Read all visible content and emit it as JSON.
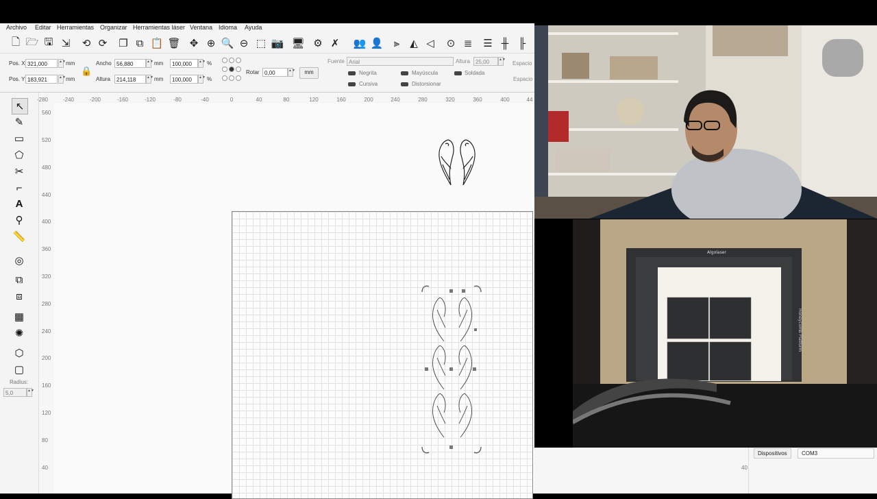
{
  "menu": [
    "Archivo",
    "Editar",
    "Herramientas",
    "Organizar",
    "Herramientas láser",
    "Ventana",
    "Idioma",
    "Ayuda"
  ],
  "props": {
    "pos_x_label": "Pos. X",
    "pos_x": "321,000",
    "pos_y_label": "Pos. Y",
    "pos_y": "183,921",
    "unit": "mm",
    "width_label": "Ancho",
    "width": "56,880",
    "height_label": "Altura",
    "height": "214,118",
    "scale_w": "100,000",
    "scale_h": "100,000",
    "percent": "%",
    "rotate_label": "Rotar",
    "rotate": "0,00",
    "mm_button": "mm",
    "font_label": "Fuente",
    "font": "Arial",
    "font_height_label": "Altura",
    "font_height": "25,00",
    "spacing_label_1": "Espacio",
    "spacing_label_2": "Espacio",
    "bold": "Negrita",
    "italic": "Cursiva",
    "uppercase": "Mayúscula",
    "distort": "Distorsionar",
    "welded": "Soldada"
  },
  "left_tools": {
    "radius_label": "Radius:",
    "radius_value": "5,0",
    "icons": [
      "select-arrow-icon",
      "pen-icon",
      "rectangle-icon",
      "polygon-icon",
      "scissors-icon",
      "corner-icon",
      "text-icon",
      "position-marker-icon",
      "ruler-icon",
      "offset-icon",
      "copy-icon",
      "group-icon",
      "grid-array-icon",
      "circular-array-icon",
      "node-edit-icon",
      "rounded-corner-icon"
    ]
  },
  "ruler_h": [
    "-280",
    "-240",
    "-200",
    "-160",
    "-120",
    "-80",
    "-40",
    "0",
    "40",
    "80",
    "120",
    "160",
    "200",
    "240",
    "280",
    "320",
    "360",
    "400",
    "44"
  ],
  "ruler_v": [
    "560",
    "520",
    "480",
    "440",
    "400",
    "360",
    "320",
    "280",
    "240",
    "200",
    "160",
    "120",
    "80",
    "40"
  ],
  "ruler_v_right": "40",
  "laser_tabs": {
    "devices": "Dispositivos",
    "port": "COM3"
  },
  "toolbar_icons": [
    "new-file-icon",
    "open-folder-icon",
    "save-icon",
    "export-icon",
    "undo-icon",
    "redo-icon",
    "copy-icon",
    "copy-paste-icon",
    "paste-icon",
    "delete-icon",
    "move-icon",
    "zoom-in-icon",
    "zoom-in-icon-2",
    "zoom-out-icon",
    "select-area-icon",
    "camera-icon",
    "monitor-icon",
    "settings-icon",
    "tools-icon",
    "group-users-icon",
    "user-icon",
    "flip-horizontal-icon",
    "mirror-icon",
    "send-icon",
    "target-icon",
    "align-icon",
    "distribute-icon",
    "spacing-icon"
  ],
  "camera": {
    "machine_brand": "Algolaser",
    "platform_label": "Honeycomb Platform"
  }
}
